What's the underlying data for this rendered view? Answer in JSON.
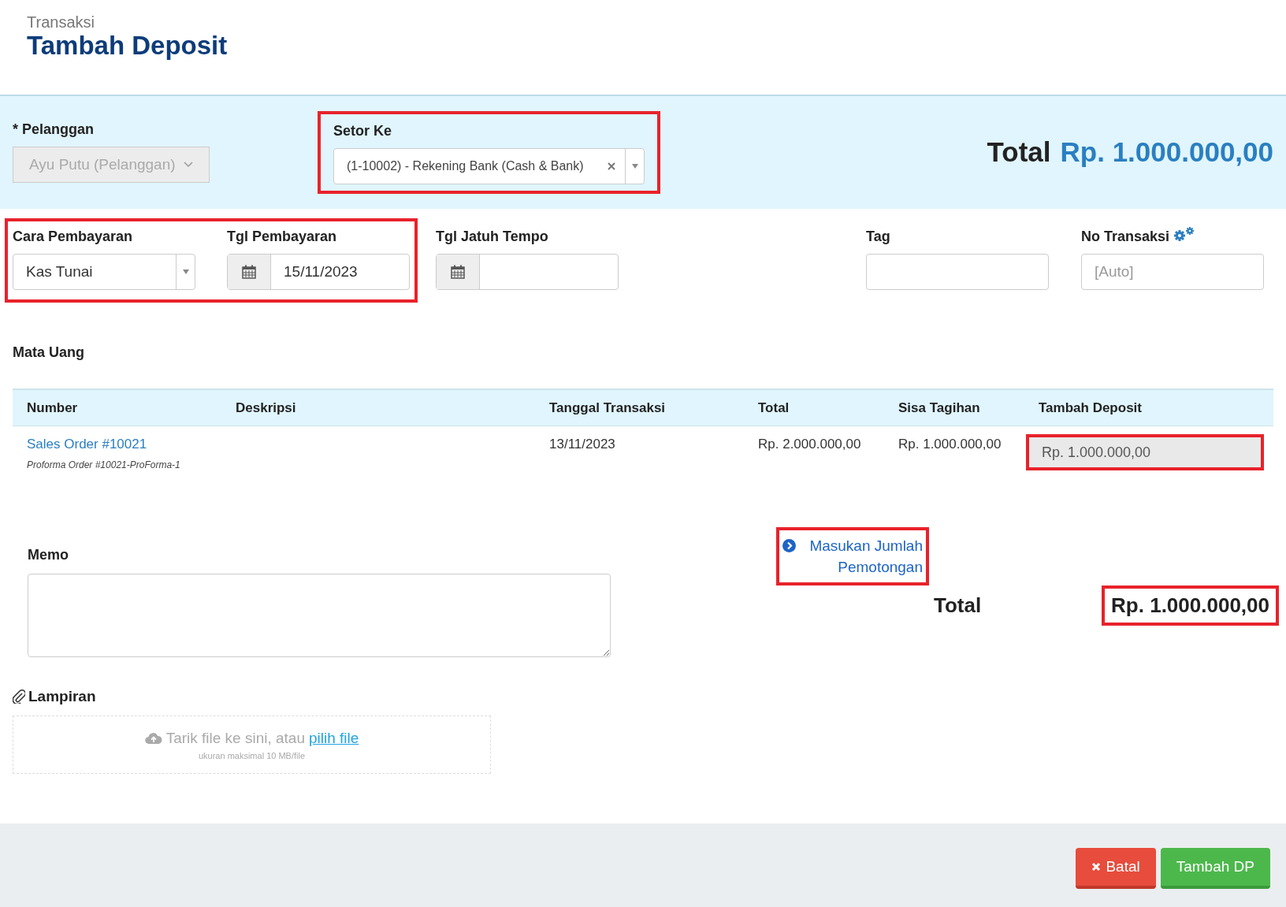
{
  "page": {
    "breadcrumb": "Transaksi",
    "title": "Tambah Deposit"
  },
  "header": {
    "customer": {
      "label": "* Pelanggan",
      "value": "Ayu Putu (Pelanggan)",
      "disabled": true
    },
    "deposit_to": {
      "label": "Setor Ke",
      "value": "(1-10002) - Rekening Bank (Cash & Bank)",
      "highlighted": true
    },
    "total": {
      "label": "Total",
      "amount": "Rp. 1.000.000,00"
    }
  },
  "payment": {
    "highlighted": true,
    "fields": [
      {
        "kind": "select",
        "label": "Cara Pembayaran",
        "value": "Kas Tunai"
      },
      {
        "kind": "date",
        "label": "Tgl Pembayaran",
        "value": "15/11/2023"
      }
    ]
  },
  "other_fields": [
    {
      "kind": "date",
      "label": "Tgl Jatuh Tempo"
    },
    {
      "kind": "text",
      "label": "Tag"
    },
    {
      "kind": "number",
      "label": "No Transaksi",
      "placeholder": "[Auto]"
    }
  ],
  "currency_label": "Mata Uang",
  "table": {
    "columns": [
      "Number",
      "Deskripsi",
      "Tanggal Transaksi",
      "Total",
      "Sisa Tagihan",
      "Tambah Deposit"
    ],
    "rows": [
      {
        "number": "Sales Order #10021",
        "note": "Proforma Order #10021-ProForma-1",
        "date": "13/11/2023",
        "total": "Rp. 2.000.000,00",
        "remaining": "Rp. 1.000.000,00",
        "deposit": "Rp. 1.000.000,00",
        "highlighted": true
      }
    ]
  },
  "memo": {
    "label": "Memo"
  },
  "summary": {
    "deduction_link": "Masukan Jumlah Pemotongan",
    "link_highlighted": true,
    "total_label": "Total",
    "total_amount": "Rp. 1.000.000,00",
    "amount_highlighted": true
  },
  "attachment": {
    "label": "Lampiran",
    "drop_text": "Tarik file ke sini, atau",
    "pick_link": "pilih file",
    "hint": "ukuran maksimal 10 MB/file"
  },
  "buttons": [
    {
      "kind": "cancel",
      "label": "Batal"
    },
    {
      "kind": "submit",
      "label": "Tambah DP"
    }
  ]
}
